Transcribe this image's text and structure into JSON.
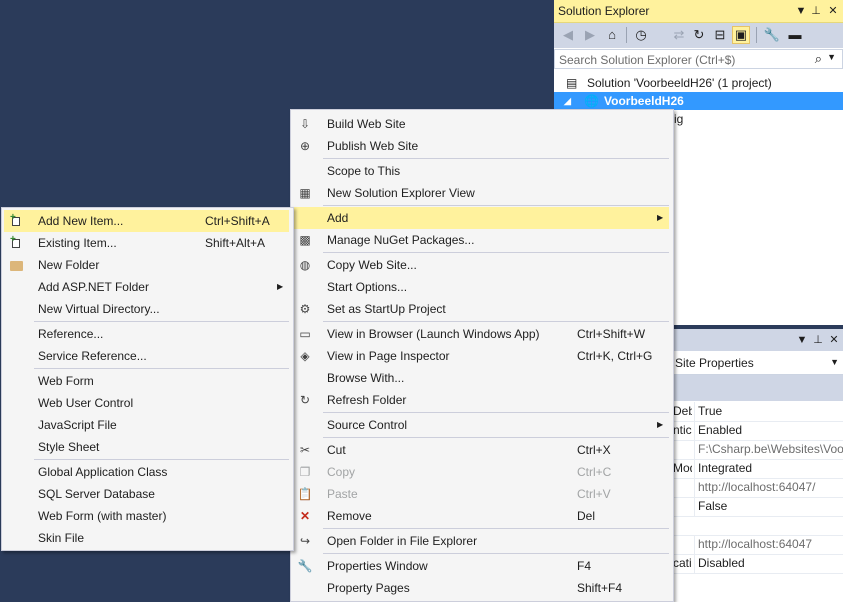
{
  "solution_explorer": {
    "title": "Solution Explorer",
    "title_buttons": [
      "▼",
      "📌",
      "✕"
    ],
    "search_placeholder": "Search Solution Explorer (Ctrl+$)",
    "toolbar_icons": [
      "back-icon",
      "forward-icon",
      "home-icon",
      "history-icon",
      "sync-icon",
      "refresh-icon",
      "collapse-icon",
      "preview-icon",
      "properties-wrench-icon",
      "pin-icon"
    ],
    "tree": [
      {
        "label": "Solution 'VoorbeeldH26' (1 project)",
        "selected": false
      },
      {
        "label": "VoorbeeldH26",
        "selected": true
      },
      {
        "label": "ig",
        "selected": false
      }
    ]
  },
  "properties": {
    "title_buttons": [
      "▼",
      "📌",
      "✕"
    ],
    "object": "Site Properties",
    "rows": [
      {
        "name": "Deb",
        "value": "True",
        "gray": false
      },
      {
        "name": "ntic",
        "value": "Enabled",
        "gray": false
      },
      {
        "name": "",
        "value": "F:\\Csharp.be\\Websites\\Voo",
        "gray": true
      },
      {
        "name": "Mod",
        "value": "Integrated",
        "gray": false
      },
      {
        "name": "",
        "value": "http://localhost:64047/",
        "gray": true
      },
      {
        "name": "",
        "value": "False",
        "gray": false
      },
      {
        "name": "",
        "value": "",
        "gray": false
      },
      {
        "name": "",
        "value": "http://localhost:64047",
        "gray": true
      },
      {
        "name": "catio",
        "value": "Disabled",
        "gray": false
      }
    ]
  },
  "main_menu": {
    "items": [
      {
        "label": "Build Web Site",
        "shortcut": "",
        "icon": "build-icon",
        "submenu": false,
        "disabled": false,
        "highlight": false
      },
      {
        "label": "Publish Web Site",
        "shortcut": "",
        "icon": "publish-icon",
        "submenu": false,
        "disabled": false,
        "highlight": false
      },
      {
        "label": "Scope to This",
        "shortcut": "",
        "icon": "",
        "submenu": false,
        "disabled": false,
        "highlight": false
      },
      {
        "label": "New Solution Explorer View",
        "shortcut": "",
        "icon": "new-view-icon",
        "submenu": false,
        "disabled": false,
        "highlight": false
      },
      {
        "label": "Add",
        "shortcut": "",
        "icon": "",
        "submenu": true,
        "disabled": false,
        "highlight": true
      },
      {
        "label": "Manage NuGet Packages...",
        "shortcut": "",
        "icon": "nuget-icon",
        "submenu": false,
        "disabled": false,
        "highlight": false
      },
      {
        "label": "Copy Web Site...",
        "shortcut": "",
        "icon": "copy-web-icon",
        "submenu": false,
        "disabled": false,
        "highlight": false
      },
      {
        "label": "Start Options...",
        "shortcut": "",
        "icon": "",
        "submenu": false,
        "disabled": false,
        "highlight": false
      },
      {
        "label": "Set as StartUp Project",
        "shortcut": "",
        "icon": "gear-icon",
        "submenu": false,
        "disabled": false,
        "highlight": false
      },
      {
        "label": "View in Browser (Launch Windows App)",
        "shortcut": "Ctrl+Shift+W",
        "icon": "browser-icon",
        "submenu": false,
        "disabled": false,
        "highlight": false
      },
      {
        "label": "View in Page Inspector",
        "shortcut": "Ctrl+K, Ctrl+G",
        "icon": "inspector-icon",
        "submenu": false,
        "disabled": false,
        "highlight": false
      },
      {
        "label": "Browse With...",
        "shortcut": "",
        "icon": "",
        "submenu": false,
        "disabled": false,
        "highlight": false
      },
      {
        "label": "Refresh Folder",
        "shortcut": "",
        "icon": "refresh-icon",
        "submenu": false,
        "disabled": false,
        "highlight": false
      },
      {
        "label": "Source Control",
        "shortcut": "",
        "icon": "",
        "submenu": true,
        "disabled": false,
        "highlight": false
      },
      {
        "label": "Cut",
        "shortcut": "Ctrl+X",
        "icon": "scissors-icon",
        "submenu": false,
        "disabled": false,
        "highlight": false
      },
      {
        "label": "Copy",
        "shortcut": "Ctrl+C",
        "icon": "copy-icon",
        "submenu": false,
        "disabled": true,
        "highlight": false
      },
      {
        "label": "Paste",
        "shortcut": "Ctrl+V",
        "icon": "paste-icon",
        "submenu": false,
        "disabled": true,
        "highlight": false
      },
      {
        "label": "Remove",
        "shortcut": "Del",
        "icon": "remove-x-icon",
        "submenu": false,
        "disabled": false,
        "highlight": false
      },
      {
        "label": "Open Folder in File Explorer",
        "shortcut": "",
        "icon": "open-folder-arrow-icon",
        "submenu": false,
        "disabled": false,
        "highlight": false
      },
      {
        "label": "Properties Window",
        "shortcut": "F4",
        "icon": "wrench-icon",
        "submenu": false,
        "disabled": false,
        "highlight": false
      },
      {
        "label": "Property Pages",
        "shortcut": "Shift+F4",
        "icon": "",
        "submenu": false,
        "disabled": false,
        "highlight": false
      }
    ]
  },
  "add_submenu": {
    "items": [
      {
        "label": "Add New Item...",
        "shortcut": "Ctrl+Shift+A",
        "icon": "new-item-icon",
        "submenu": false,
        "highlight": true
      },
      {
        "label": "Existing Item...",
        "shortcut": "Shift+Alt+A",
        "icon": "existing-item-icon",
        "submenu": false,
        "highlight": false
      },
      {
        "label": "New Folder",
        "shortcut": "",
        "icon": "folder-icon",
        "submenu": false,
        "highlight": false
      },
      {
        "label": "Add ASP.NET Folder",
        "shortcut": "",
        "icon": "",
        "submenu": true,
        "highlight": false
      },
      {
        "label": "New Virtual Directory...",
        "shortcut": "",
        "icon": "",
        "submenu": false,
        "highlight": false
      },
      {
        "label": "Reference...",
        "shortcut": "",
        "icon": "",
        "submenu": false,
        "highlight": false
      },
      {
        "label": "Service Reference...",
        "shortcut": "",
        "icon": "",
        "submenu": false,
        "highlight": false
      },
      {
        "label": "Web Form",
        "shortcut": "",
        "icon": "",
        "submenu": false,
        "highlight": false
      },
      {
        "label": "Web User Control",
        "shortcut": "",
        "icon": "",
        "submenu": false,
        "highlight": false
      },
      {
        "label": "JavaScript File",
        "shortcut": "",
        "icon": "",
        "submenu": false,
        "highlight": false
      },
      {
        "label": "Style Sheet",
        "shortcut": "",
        "icon": "",
        "submenu": false,
        "highlight": false
      },
      {
        "label": "Global Application Class",
        "shortcut": "",
        "icon": "",
        "submenu": false,
        "highlight": false
      },
      {
        "label": "SQL Server Database",
        "shortcut": "",
        "icon": "",
        "submenu": false,
        "highlight": false
      },
      {
        "label": "Web Form (with master)",
        "shortcut": "",
        "icon": "",
        "submenu": false,
        "highlight": false
      },
      {
        "label": "Skin File",
        "shortcut": "",
        "icon": "",
        "submenu": false,
        "highlight": false
      }
    ]
  },
  "colors": {
    "background": "#2b3b5a",
    "highlight": "#fff29d",
    "selection": "#3399ff"
  }
}
